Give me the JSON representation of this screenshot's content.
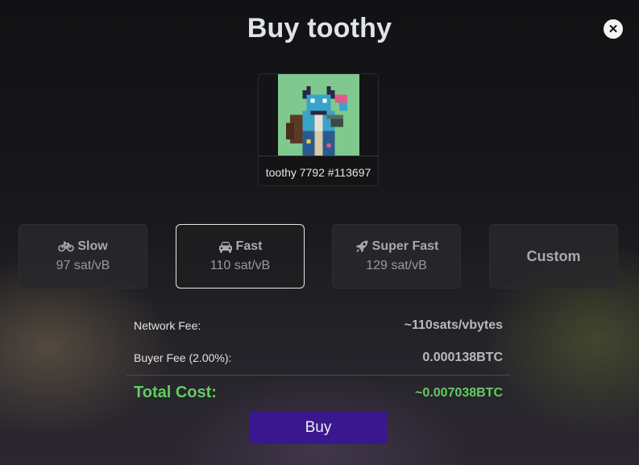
{
  "dialog": {
    "title": "Buy toothy",
    "close_icon": "close-icon"
  },
  "nft": {
    "name": "toothy 7792 #113697",
    "image_icon": "pixel-art-toothy-image"
  },
  "fee_options": [
    {
      "label": "Slow",
      "rate": "97 sat/vB",
      "icon": "bicycle-icon",
      "selected": false
    },
    {
      "label": "Fast",
      "rate": "110 sat/vB",
      "icon": "car-icon",
      "selected": true
    },
    {
      "label": "Super Fast",
      "rate": "129 sat/vB",
      "icon": "rocket-icon",
      "selected": false
    },
    {
      "label": "Custom",
      "selected": false
    }
  ],
  "summary": {
    "network_fee_label": "Network Fee:",
    "network_fee_value": "~110sats/vbytes",
    "buyer_fee_label": "Buyer Fee (2.00%):",
    "buyer_fee_value": "0.000138BTC",
    "total_label": "Total Cost:",
    "total_value": "~0.007038BTC"
  },
  "buy_button": {
    "label": "Buy"
  },
  "colors": {
    "accent": "#3b178f",
    "total_green": "#5fce5f",
    "selected_border": "#e8e8e8"
  }
}
